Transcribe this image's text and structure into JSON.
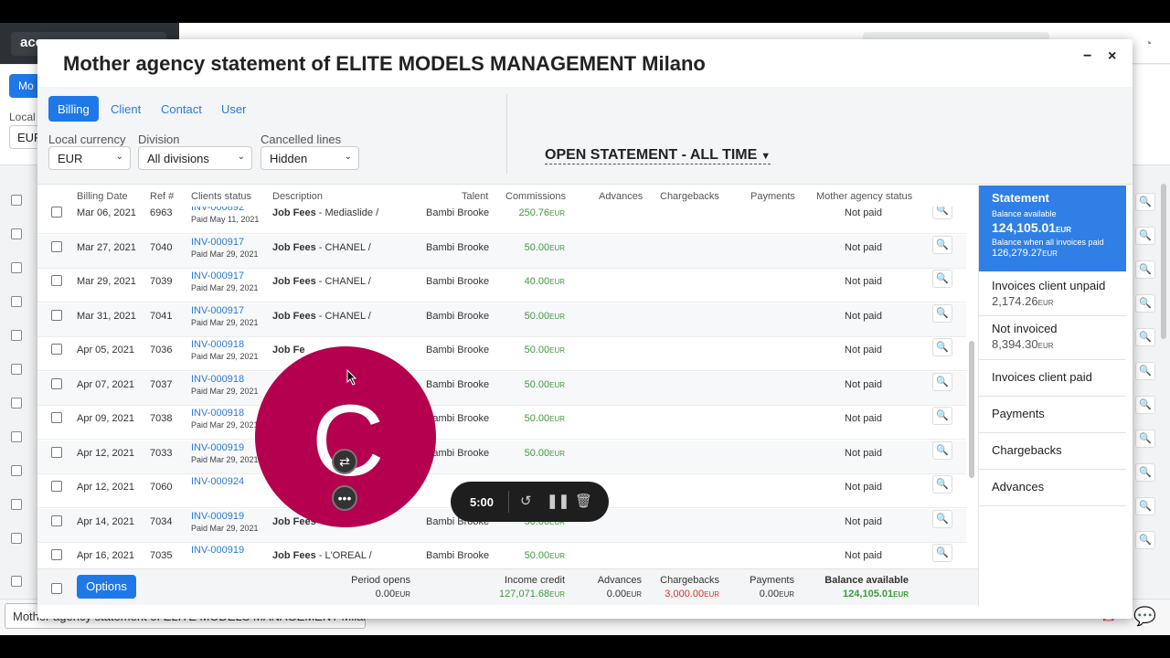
{
  "background": {
    "logo_text": "acc",
    "button_text": "Mo",
    "local_label": "Local",
    "currency_value": "EUR",
    "taskbar_title": "Mother agency statement of ELITE MODELS MANAGEMENT Milano"
  },
  "modal": {
    "title": "Mother agency statement of ELITE MODELS MANAGEMENT Milano",
    "minimize_glyph": "−",
    "close_glyph": "×"
  },
  "tabs": [
    {
      "label": "Billing",
      "active": true
    },
    {
      "label": "Client",
      "active": false
    },
    {
      "label": "Contact",
      "active": false
    },
    {
      "label": "User",
      "active": false
    }
  ],
  "filters": {
    "currency": {
      "label": "Local currency",
      "value": "EUR"
    },
    "division": {
      "label": "Division",
      "value": "All divisions"
    },
    "cancelled": {
      "label": "Cancelled lines",
      "value": "Hidden"
    },
    "statement_period": "OPEN STATEMENT - ALL TIME"
  },
  "columns": [
    "Billing Date",
    "Ref #",
    "Clients status",
    "Description",
    "Talent",
    "Commissions",
    "Advances",
    "Chargebacks",
    "Payments",
    "Mother agency status"
  ],
  "rows": [
    {
      "date": "Mar 06, 2021",
      "ref": "6963",
      "invoice": "INV-000892",
      "paid": "Paid May 11, 2021",
      "desc_bold": "Job Fees",
      "desc_rest": " - Mediaslide /",
      "talent": "Bambi Brooke",
      "commission": "250.76",
      "status": "Not paid"
    },
    {
      "date": "Mar 27, 2021",
      "ref": "7040",
      "invoice": "INV-000917",
      "paid": "Paid Mar 29, 2021",
      "desc_bold": "Job Fees",
      "desc_rest": " - CHANEL /",
      "talent": "Bambi Brooke",
      "commission": "50.00",
      "status": "Not paid"
    },
    {
      "date": "Mar 29, 2021",
      "ref": "7039",
      "invoice": "INV-000917",
      "paid": "Paid Mar 29, 2021",
      "desc_bold": "Job Fees",
      "desc_rest": " - CHANEL /",
      "talent": "Bambi Brooke",
      "commission": "40.00",
      "status": "Not paid"
    },
    {
      "date": "Mar 31, 2021",
      "ref": "7041",
      "invoice": "INV-000917",
      "paid": "Paid Mar 29, 2021",
      "desc_bold": "Job Fees",
      "desc_rest": " - CHANEL /",
      "talent": "Bambi Brooke",
      "commission": "50.00",
      "status": "Not paid"
    },
    {
      "date": "Apr 05, 2021",
      "ref": "7036",
      "invoice": "INV-000918",
      "paid": "Paid Mar 29, 2021",
      "desc_bold": "Job Fe",
      "desc_rest": "",
      "talent": "Bambi Brooke",
      "commission": "50.00",
      "status": "Not paid"
    },
    {
      "date": "Apr 07, 2021",
      "ref": "7037",
      "invoice": "INV-000918",
      "paid": "Paid Mar 29, 2021",
      "desc_bold": "",
      "desc_rest": "",
      "talent": "Bambi Brooke",
      "commission": "50.00",
      "status": "Not paid"
    },
    {
      "date": "Apr 09, 2021",
      "ref": "7038",
      "invoice": "INV-000918",
      "paid": "Paid Mar 29, 2021",
      "desc_bold": "",
      "desc_rest": "",
      "talent": "Bambi Brooke",
      "commission": "50.00",
      "status": "Not paid"
    },
    {
      "date": "Apr 12, 2021",
      "ref": "7033",
      "invoice": "INV-000919",
      "paid": "Paid Mar 29, 2021",
      "desc_bold": "",
      "desc_rest": "",
      "talent": "Bambi Brooke",
      "commission": "50.00",
      "status": "Not paid"
    },
    {
      "date": "Apr 12, 2021",
      "ref": "7060",
      "invoice": "INV-000924",
      "paid": "",
      "desc_bold": "",
      "desc_rest": "",
      "talent": "",
      "commission": "",
      "status": "Not paid"
    },
    {
      "date": "Apr 14, 2021",
      "ref": "7034",
      "invoice": "INV-000919",
      "paid": "Paid Mar 29, 2021",
      "desc_bold": "Job Fees",
      "desc_rest": " - L'OREAL /",
      "talent": "Bambi Brooke",
      "commission": "50.00",
      "status": "Not paid"
    },
    {
      "date": "Apr 16, 2021",
      "ref": "7035",
      "invoice": "INV-000919",
      "paid": "",
      "desc_bold": "Job Fees",
      "desc_rest": " - L'OREAL /",
      "talent": "Bambi Brooke",
      "commission": "50.00",
      "status": "Not paid"
    }
  ],
  "currency_suffix": "EUR",
  "summary": {
    "options_label": "Options",
    "period_opens": {
      "label": "Period opens",
      "value": "0.00"
    },
    "income_credit": {
      "label": "Income credit",
      "value": "127,071.68"
    },
    "advances": {
      "label": "Advances",
      "value": "0.00"
    },
    "chargebacks": {
      "label": "Chargebacks",
      "value": "3,000.00"
    },
    "payments": {
      "label": "Payments",
      "value": "0.00"
    },
    "balance": {
      "label": "Balance available",
      "value": "124,105.01"
    }
  },
  "side_panel": {
    "statement_title": "Statement",
    "balance_available_label": "Balance available",
    "balance_available_value": "124,105.01",
    "balance_all_paid_label": "Balance when all invoices paid",
    "balance_all_paid_value": "126,279.27",
    "items": [
      {
        "label": "Invoices client unpaid",
        "value": "2,174.26"
      },
      {
        "label": "Not invoiced",
        "value": "8,394.30"
      },
      {
        "label": "Invoices client paid",
        "value": ""
      },
      {
        "label": "Payments",
        "value": ""
      },
      {
        "label": "Chargebacks",
        "value": ""
      },
      {
        "label": "Advances",
        "value": ""
      }
    ]
  },
  "recorder": {
    "avatar_letter": "C",
    "timer": "5:00"
  },
  "colors": {
    "accent": "#1f78e8",
    "positive": "#3f9a3f",
    "negative": "#d33333",
    "recorder_bubble": "#b5004f"
  }
}
